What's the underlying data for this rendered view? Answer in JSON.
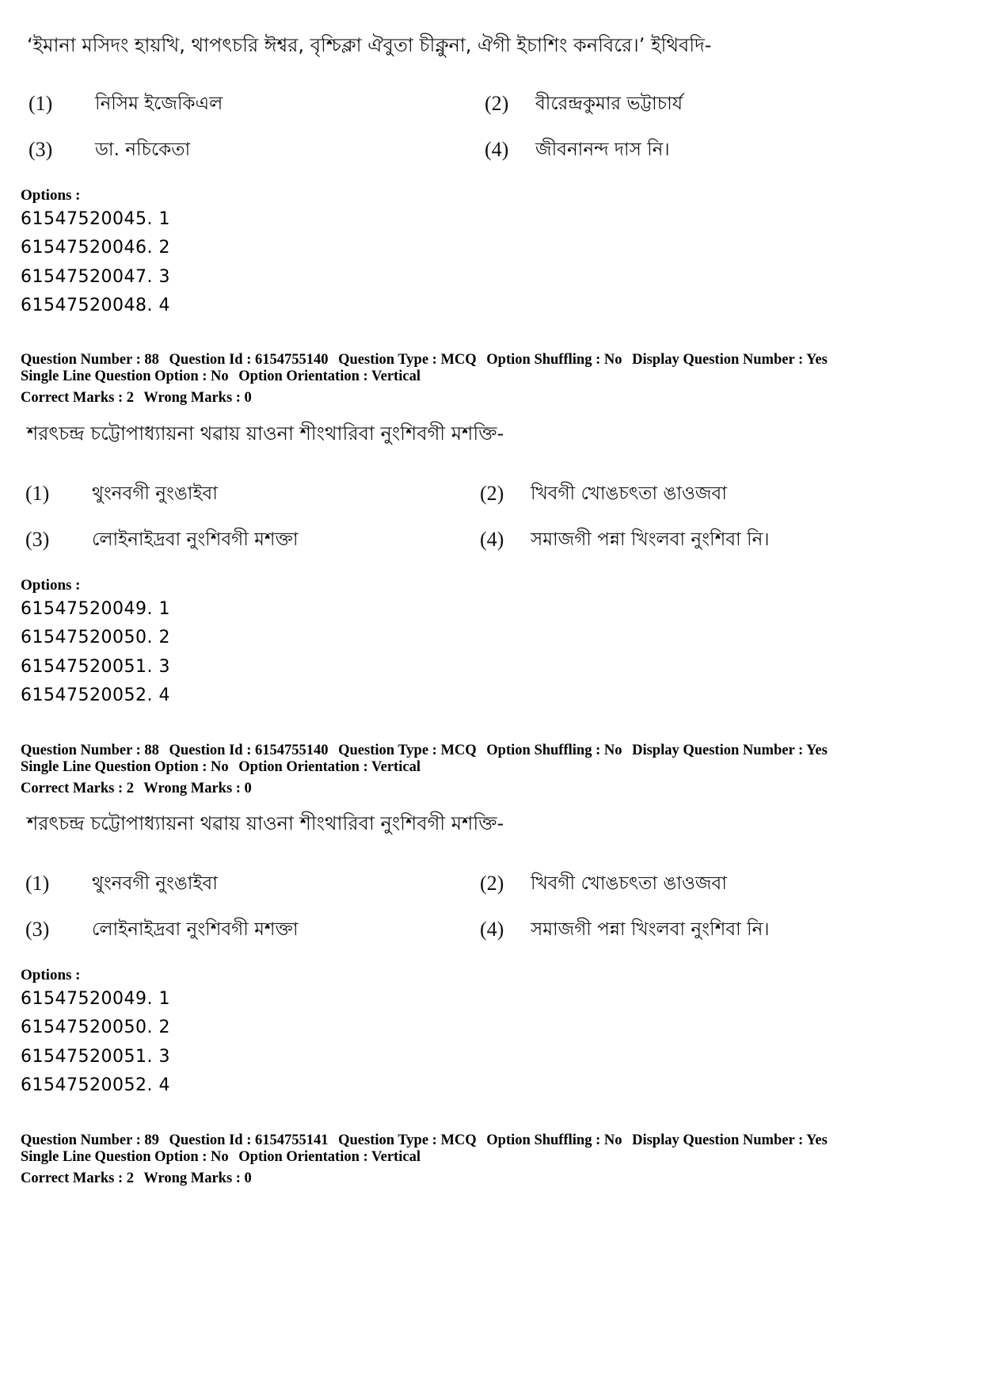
{
  "blocks": [
    {
      "question_text": "‘ইমানা মসিদং হায়খি, থাপৎচরি ঈশ্বর, বৃশ্চিক্লা ঐবুতা চীক্নুনা, ঐগী ইচাশিং কনবিরে।’ ইথিবদি-",
      "choices": [
        {
          "num": "(1)",
          "text": "নিসিম ইজেকিএল"
        },
        {
          "num": "(2)",
          "text": "বীরেন্দ্রকুমার ভট্টাচার্য"
        },
        {
          "num": "(3)",
          "text": "ডা. নচিকেতা"
        },
        {
          "num": "(4)",
          "text": "জীবনানন্দ দাস    নি।"
        }
      ],
      "options_label": "Options :",
      "option_ids": [
        "61547520045. 1",
        "61547520046. 2",
        "61547520047. 3",
        "61547520048. 4"
      ]
    },
    {
      "meta": {
        "question_number": "Question Number : 88",
        "question_id": "Question Id : 6154755140",
        "question_type": "Question Type : MCQ",
        "option_shuffling": "Option Shuffling : No",
        "display_question_number": "Display Question Number : Yes",
        "single_line": "Single Line Question Option : No",
        "orientation": "Option Orientation : Vertical",
        "correct_marks": "Correct Marks : 2",
        "wrong_marks": "Wrong Marks : 0"
      },
      "question_text": "শরৎচন্দ্র চট্টোপাধ্যায়না থৱায় য়াওনা শীংথারিবা নুংশিবগী মশক্তি-",
      "choices": [
        {
          "num": "(1)",
          "text": "থুংনবগী নুংঙাইবা"
        },
        {
          "num": "(2)",
          "text": "খিবগী খোঙচৎতা ঙাওজবা"
        },
        {
          "num": "(3)",
          "text": "লোইনাইদ্রবা নুংশিবগী মশক্তা"
        },
        {
          "num": "(4)",
          "text": "সমাজগী পন্না খিংলবা নুংশিবা     নি।"
        }
      ],
      "options_label": "Options :",
      "option_ids": [
        "61547520049. 1",
        "61547520050. 2",
        "61547520051. 3",
        "61547520052. 4"
      ]
    },
    {
      "meta": {
        "question_number": "Question Number : 88",
        "question_id": "Question Id : 6154755140",
        "question_type": "Question Type : MCQ",
        "option_shuffling": "Option Shuffling : No",
        "display_question_number": "Display Question Number : Yes",
        "single_line": "Single Line Question Option : No",
        "orientation": "Option Orientation : Vertical",
        "correct_marks": "Correct Marks : 2",
        "wrong_marks": "Wrong Marks : 0"
      },
      "question_text": "শরৎচন্দ্র চট্টোপাধ্যায়না থৱায় য়াওনা শীংথারিবা নুংশিবগী মশক্তি-",
      "choices": [
        {
          "num": "(1)",
          "text": "থুংনবগী নুংঙাইবা"
        },
        {
          "num": "(2)",
          "text": "খিবগী খোঙচৎতা ঙাওজবা"
        },
        {
          "num": "(3)",
          "text": "লোইনাইদ্রবা নুংশিবগী মশক্তা"
        },
        {
          "num": "(4)",
          "text": "সমাজগী পন্না খিংলবা নুংশিবা     নি।"
        }
      ],
      "options_label": "Options :",
      "option_ids": [
        "61547520049. 1",
        "61547520050. 2",
        "61547520051. 3",
        "61547520052. 4"
      ]
    },
    {
      "meta": {
        "question_number": "Question Number : 89",
        "question_id": "Question Id : 6154755141",
        "question_type": "Question Type : MCQ",
        "option_shuffling": "Option Shuffling : No",
        "display_question_number": "Display Question Number : Yes",
        "single_line": "Single Line Question Option : No",
        "orientation": "Option Orientation : Vertical",
        "correct_marks": "Correct Marks : 2",
        "wrong_marks": "Wrong Marks : 0"
      }
    }
  ]
}
